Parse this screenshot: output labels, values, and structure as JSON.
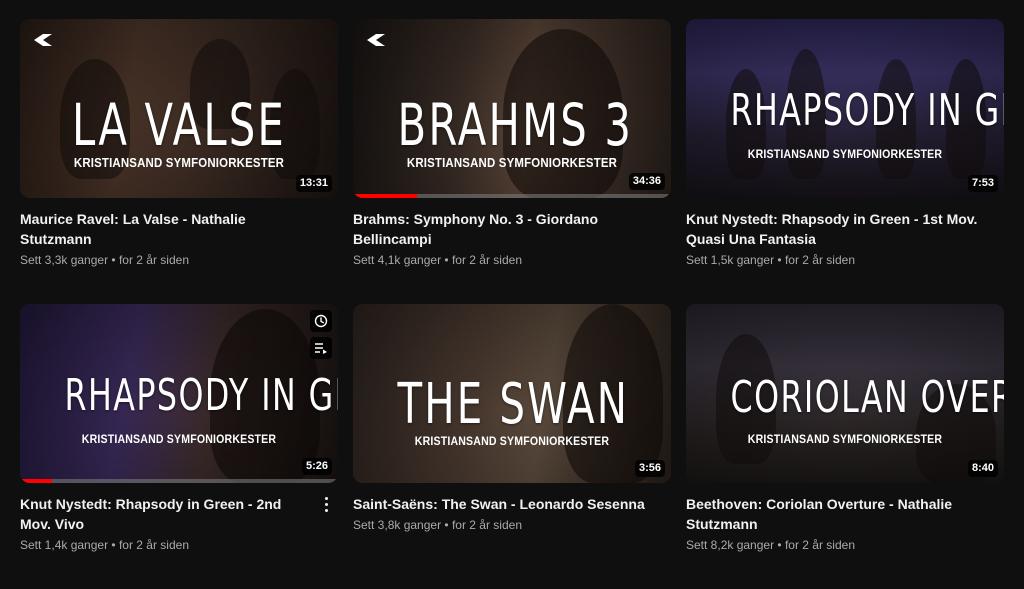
{
  "videos": [
    {
      "overlay_title": "LA VALSE",
      "overlay_sub": "KRISTIANSAND SYMFONIORKESTER",
      "duration": "13:31",
      "title": "Maurice Ravel: La Valse - Nathalie Stutzmann",
      "views": "Sett 3,3k ganger",
      "age": "for 2 år siden",
      "has_logo": true,
      "progress": 0
    },
    {
      "overlay_title": "BRAHMS 3",
      "overlay_sub": "KRISTIANSAND SYMFONIORKESTER",
      "duration": "34:36",
      "title": "Brahms: Symphony No. 3 - Giordano Bellincampi",
      "views": "Sett 4,1k ganger",
      "age": "for 2 år siden",
      "has_logo": true,
      "progress": 0.2
    },
    {
      "overlay_title": "RHAPSODY IN GREEN",
      "overlay_sub": "KRISTIANSAND SYMFONIORKESTER",
      "duration": "7:53",
      "title": "Knut Nystedt: Rhapsody in Green - 1st Mov. Quasi Una Fantasia",
      "views": "Sett 1,5k ganger",
      "age": "for 2 år siden",
      "has_logo": false,
      "progress": 0
    },
    {
      "overlay_title": "RHAPSODY IN GREEN",
      "overlay_sub": "KRISTIANSAND SYMFONIORKESTER",
      "duration": "5:26",
      "title": "Knut Nystedt: Rhapsody in Green - 2nd Mov. Vivo",
      "views": "Sett 1,4k ganger",
      "age": "for 2 år siden",
      "has_logo": false,
      "progress": 0.1
    },
    {
      "overlay_title": "THE SWAN",
      "overlay_sub": "KRISTIANSAND SYMFONIORKESTER",
      "duration": "3:56",
      "title": "Saint-Saëns: The Swan - Leonardo Sesenna",
      "views": "Sett 3,8k ganger",
      "age": "for 2 år siden",
      "has_logo": false,
      "progress": 0
    },
    {
      "overlay_title": "CORIOLAN OVERTURE",
      "overlay_sub": "KRISTIANSAND SYMFONIORKESTER",
      "duration": "8:40",
      "title": "Beethoven: Coriolan Overture - Nathalie Stutzmann",
      "views": "Sett 8,2k ganger",
      "age": "for 2 år siden",
      "has_logo": false,
      "progress": 0
    }
  ],
  "hovered_card": {
    "watch_later_icon": "clock-icon",
    "add_to_queue_icon": "queue-icon",
    "menu_icon": "more-vert-icon"
  },
  "colors": {
    "background": "#0f0f0f",
    "title_text": "#f1f1f1",
    "meta_text": "#aaaaaa",
    "progress": "#ff0000"
  },
  "separator": "•"
}
